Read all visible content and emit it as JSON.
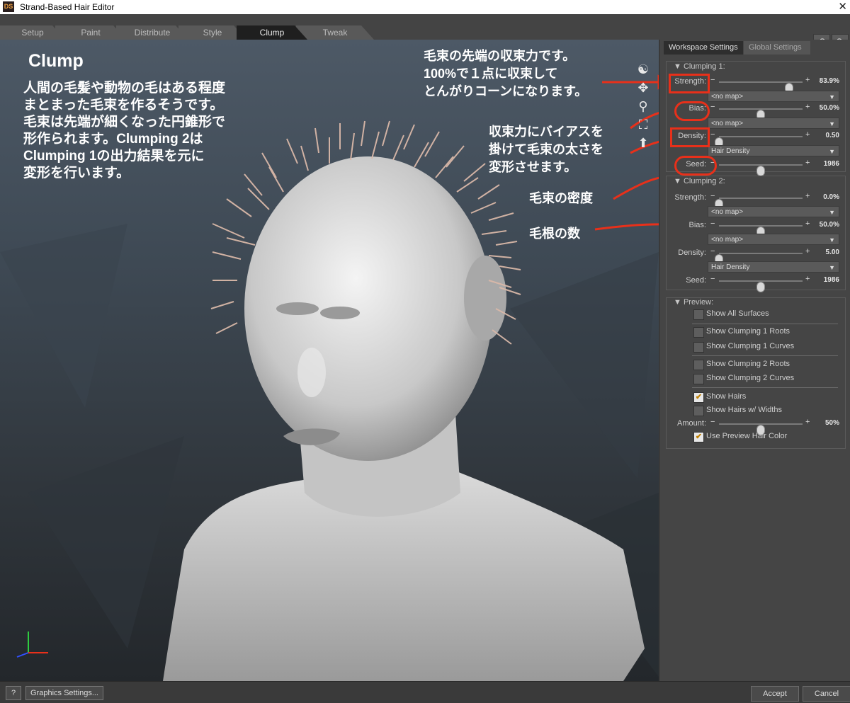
{
  "window": {
    "title": "Strand-Based Hair Editor",
    "close_glyph": "✕"
  },
  "tabs": [
    "Setup",
    "Paint",
    "Distribute",
    "Style",
    "Clump",
    "Tweak"
  ],
  "top_buttons": {
    "undo": "↶",
    "redo": "↷"
  },
  "viewport": {
    "heading": "Clump",
    "description": [
      "人間の毛髪や動物の毛はある程度",
      "まとまった毛束を作るそうです。",
      "毛束は先端が細くなった円錐形で",
      "形作られます。Clumping 2は",
      "Clumping 1の出力結果を元に",
      "変形を行います。"
    ],
    "annotation_strength": [
      "毛束の先端の収束力です。",
      "100%で１点に収束して",
      "とんがりコーンになります。"
    ],
    "annotation_bias": [
      "収束力にバイアスを",
      "掛けて毛束の太さを",
      "変形させます。"
    ],
    "annotation_density": "毛束の密度",
    "annotation_seed": "毛根の数",
    "tool_icons": [
      "orbit-icon",
      "pan-icon",
      "zoom-icon",
      "frame-icon",
      "up-arrow-icon"
    ]
  },
  "sidebar": {
    "tabs": [
      "Workspace Settings",
      "Global Settings"
    ],
    "clumping1": {
      "title": "▼ Clumping 1:",
      "strength": {
        "label": "Strength:",
        "value": "83.9%",
        "level": 0.839,
        "map": "<no map>"
      },
      "bias": {
        "label": "Bias:",
        "value": "50.0%",
        "level": 0.5,
        "map": "<no map>"
      },
      "density": {
        "label": "Density:",
        "value": "0.50",
        "level": 0.0,
        "map": "Hair Density"
      },
      "seed": {
        "label": "Seed:",
        "value": "1986",
        "level": 0.5
      }
    },
    "clumping2": {
      "title": "▼ Clumping 2:",
      "strength": {
        "label": "Strength:",
        "value": "0.0%",
        "level": 0.0,
        "map": "<no map>"
      },
      "bias": {
        "label": "Bias:",
        "value": "50.0%",
        "level": 0.5,
        "map": "<no map>"
      },
      "density": {
        "label": "Density:",
        "value": "5.00",
        "level": 0.0,
        "map": "Hair Density"
      },
      "seed": {
        "label": "Seed:",
        "value": "1986",
        "level": 0.5
      }
    },
    "preview": {
      "title": "▼ Preview:",
      "items": [
        {
          "label": "Show All Surfaces",
          "checked": false
        },
        {
          "label": "Show Clumping 1 Roots",
          "checked": false
        },
        {
          "label": "Show Clumping 1 Curves",
          "checked": false
        },
        {
          "label": "Show Clumping 2 Roots",
          "checked": false
        },
        {
          "label": "Show Clumping 2 Curves",
          "checked": false
        },
        {
          "label": "Show Hairs",
          "checked": true
        },
        {
          "label": "Show Hairs w/ Widths",
          "checked": false
        }
      ],
      "amount": {
        "label": "Amount:",
        "value": "50%",
        "level": 0.5
      },
      "use_color": {
        "label": "Use Preview Hair Color",
        "checked": true
      }
    }
  },
  "bottom": {
    "help": "?",
    "graphics_settings": "Graphics Settings...",
    "accept": "Accept",
    "cancel": "Cancel"
  },
  "colors": {
    "annotation_red": "#e8301a",
    "hair": "#d9b8a8",
    "check": "#f0b020"
  }
}
